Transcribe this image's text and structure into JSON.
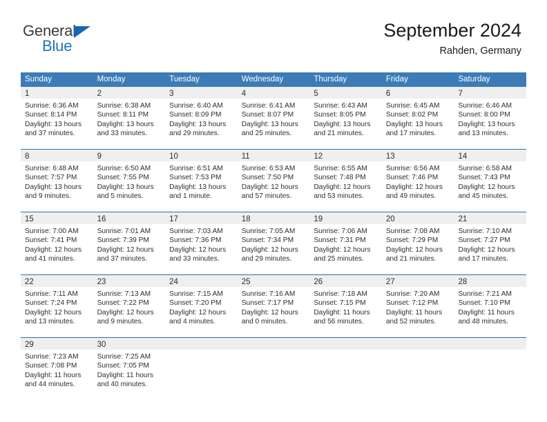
{
  "brand": {
    "name_top": "General",
    "name_bottom": "Blue",
    "accent_color": "#1b75bb",
    "triangle_color": "#1567b3"
  },
  "header": {
    "title": "September 2024",
    "location": "Rahden, Germany"
  },
  "calendar": {
    "header_bg": "#3b7cb8",
    "header_text_color": "#ffffff",
    "daynum_band_color": "#efefef",
    "weekday_headers": [
      "Sunday",
      "Monday",
      "Tuesday",
      "Wednesday",
      "Thursday",
      "Friday",
      "Saturday"
    ],
    "weeks": [
      [
        {
          "day": "1",
          "lines": [
            "Sunrise: 6:36 AM",
            "Sunset: 8:14 PM",
            "Daylight: 13 hours",
            "and 37 minutes."
          ]
        },
        {
          "day": "2",
          "lines": [
            "Sunrise: 6:38 AM",
            "Sunset: 8:11 PM",
            "Daylight: 13 hours",
            "and 33 minutes."
          ]
        },
        {
          "day": "3",
          "lines": [
            "Sunrise: 6:40 AM",
            "Sunset: 8:09 PM",
            "Daylight: 13 hours",
            "and 29 minutes."
          ]
        },
        {
          "day": "4",
          "lines": [
            "Sunrise: 6:41 AM",
            "Sunset: 8:07 PM",
            "Daylight: 13 hours",
            "and 25 minutes."
          ]
        },
        {
          "day": "5",
          "lines": [
            "Sunrise: 6:43 AM",
            "Sunset: 8:05 PM",
            "Daylight: 13 hours",
            "and 21 minutes."
          ]
        },
        {
          "day": "6",
          "lines": [
            "Sunrise: 6:45 AM",
            "Sunset: 8:02 PM",
            "Daylight: 13 hours",
            "and 17 minutes."
          ]
        },
        {
          "day": "7",
          "lines": [
            "Sunrise: 6:46 AM",
            "Sunset: 8:00 PM",
            "Daylight: 13 hours",
            "and 13 minutes."
          ]
        }
      ],
      [
        {
          "day": "8",
          "lines": [
            "Sunrise: 6:48 AM",
            "Sunset: 7:57 PM",
            "Daylight: 13 hours",
            "and 9 minutes."
          ]
        },
        {
          "day": "9",
          "lines": [
            "Sunrise: 6:50 AM",
            "Sunset: 7:55 PM",
            "Daylight: 13 hours",
            "and 5 minutes."
          ]
        },
        {
          "day": "10",
          "lines": [
            "Sunrise: 6:51 AM",
            "Sunset: 7:53 PM",
            "Daylight: 13 hours",
            "and 1 minute."
          ]
        },
        {
          "day": "11",
          "lines": [
            "Sunrise: 6:53 AM",
            "Sunset: 7:50 PM",
            "Daylight: 12 hours",
            "and 57 minutes."
          ]
        },
        {
          "day": "12",
          "lines": [
            "Sunrise: 6:55 AM",
            "Sunset: 7:48 PM",
            "Daylight: 12 hours",
            "and 53 minutes."
          ]
        },
        {
          "day": "13",
          "lines": [
            "Sunrise: 6:56 AM",
            "Sunset: 7:46 PM",
            "Daylight: 12 hours",
            "and 49 minutes."
          ]
        },
        {
          "day": "14",
          "lines": [
            "Sunrise: 6:58 AM",
            "Sunset: 7:43 PM",
            "Daylight: 12 hours",
            "and 45 minutes."
          ]
        }
      ],
      [
        {
          "day": "15",
          "lines": [
            "Sunrise: 7:00 AM",
            "Sunset: 7:41 PM",
            "Daylight: 12 hours",
            "and 41 minutes."
          ]
        },
        {
          "day": "16",
          "lines": [
            "Sunrise: 7:01 AM",
            "Sunset: 7:39 PM",
            "Daylight: 12 hours",
            "and 37 minutes."
          ]
        },
        {
          "day": "17",
          "lines": [
            "Sunrise: 7:03 AM",
            "Sunset: 7:36 PM",
            "Daylight: 12 hours",
            "and 33 minutes."
          ]
        },
        {
          "day": "18",
          "lines": [
            "Sunrise: 7:05 AM",
            "Sunset: 7:34 PM",
            "Daylight: 12 hours",
            "and 29 minutes."
          ]
        },
        {
          "day": "19",
          "lines": [
            "Sunrise: 7:06 AM",
            "Sunset: 7:31 PM",
            "Daylight: 12 hours",
            "and 25 minutes."
          ]
        },
        {
          "day": "20",
          "lines": [
            "Sunrise: 7:08 AM",
            "Sunset: 7:29 PM",
            "Daylight: 12 hours",
            "and 21 minutes."
          ]
        },
        {
          "day": "21",
          "lines": [
            "Sunrise: 7:10 AM",
            "Sunset: 7:27 PM",
            "Daylight: 12 hours",
            "and 17 minutes."
          ]
        }
      ],
      [
        {
          "day": "22",
          "lines": [
            "Sunrise: 7:11 AM",
            "Sunset: 7:24 PM",
            "Daylight: 12 hours",
            "and 13 minutes."
          ]
        },
        {
          "day": "23",
          "lines": [
            "Sunrise: 7:13 AM",
            "Sunset: 7:22 PM",
            "Daylight: 12 hours",
            "and 9 minutes."
          ]
        },
        {
          "day": "24",
          "lines": [
            "Sunrise: 7:15 AM",
            "Sunset: 7:20 PM",
            "Daylight: 12 hours",
            "and 4 minutes."
          ]
        },
        {
          "day": "25",
          "lines": [
            "Sunrise: 7:16 AM",
            "Sunset: 7:17 PM",
            "Daylight: 12 hours",
            "and 0 minutes."
          ]
        },
        {
          "day": "26",
          "lines": [
            "Sunrise: 7:18 AM",
            "Sunset: 7:15 PM",
            "Daylight: 11 hours",
            "and 56 minutes."
          ]
        },
        {
          "day": "27",
          "lines": [
            "Sunrise: 7:20 AM",
            "Sunset: 7:12 PM",
            "Daylight: 11 hours",
            "and 52 minutes."
          ]
        },
        {
          "day": "28",
          "lines": [
            "Sunrise: 7:21 AM",
            "Sunset: 7:10 PM",
            "Daylight: 11 hours",
            "and 48 minutes."
          ]
        }
      ],
      [
        {
          "day": "29",
          "lines": [
            "Sunrise: 7:23 AM",
            "Sunset: 7:08 PM",
            "Daylight: 11 hours",
            "and 44 minutes."
          ]
        },
        {
          "day": "30",
          "lines": [
            "Sunrise: 7:25 AM",
            "Sunset: 7:05 PM",
            "Daylight: 11 hours",
            "and 40 minutes."
          ]
        },
        {
          "day": "",
          "lines": []
        },
        {
          "day": "",
          "lines": []
        },
        {
          "day": "",
          "lines": []
        },
        {
          "day": "",
          "lines": []
        },
        {
          "day": "",
          "lines": []
        }
      ]
    ]
  }
}
